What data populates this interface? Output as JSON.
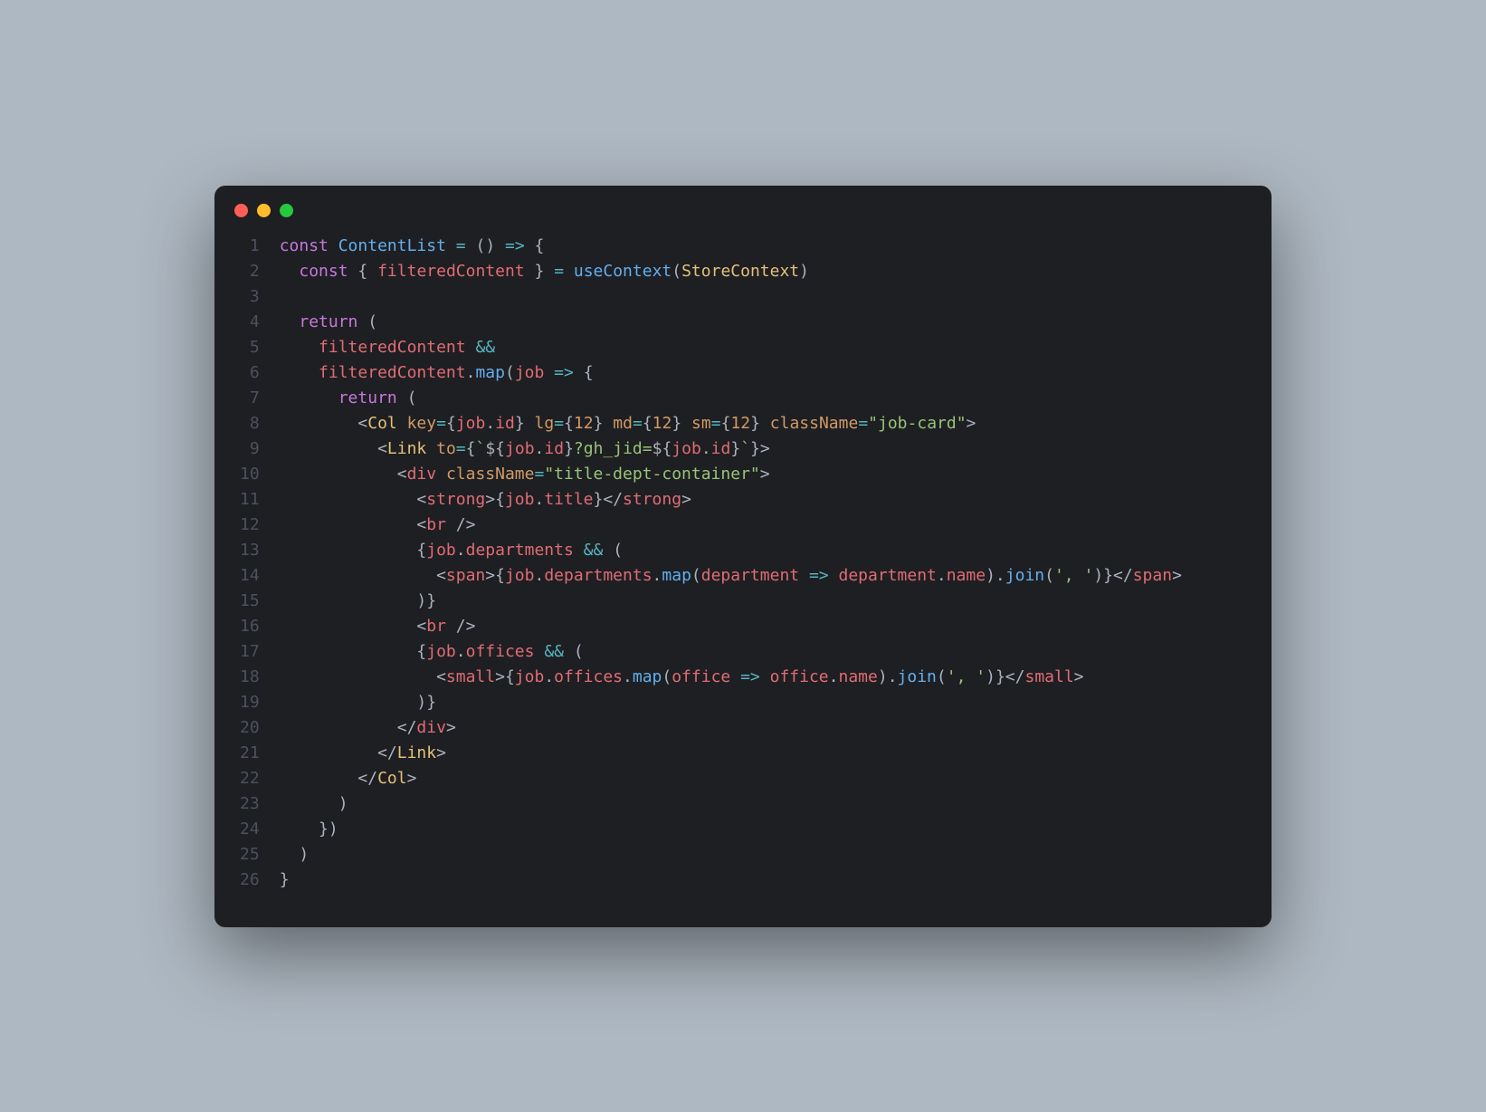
{
  "window": {
    "traffic_lights": {
      "red": "#ff5f56",
      "yellow": "#ffbd2e",
      "green": "#27c93f"
    }
  },
  "editor": {
    "line_count": 26,
    "lines": {
      "l1": "const ContentList = () => {",
      "l2": "  const { filteredContent } = useContext(StoreContext)",
      "l3": "",
      "l4": "  return (",
      "l5": "    filteredContent &&",
      "l6": "    filteredContent.map(job => {",
      "l7": "      return (",
      "l8": "        <Col key={job.id} lg={12} md={12} sm={12} className=\"job-card\">",
      "l9": "          <Link to={`${job.id}?gh_jid=${job.id}`}>",
      "l10": "            <div className=\"title-dept-container\">",
      "l11": "              <strong>{job.title}</strong>",
      "l12": "              <br />",
      "l13": "              {job.departments && (",
      "l14": "                <span>{job.departments.map(department => department.name).join(', ')}</span>",
      "l15": "              )}",
      "l16": "              <br />",
      "l17": "              {job.offices && (",
      "l18": "                <small>{job.offices.map(office => office.name).join(', ')}</small>",
      "l19": "              )}",
      "l20": "            </div>",
      "l21": "          </Link>",
      "l22": "        </Col>",
      "l23": "      )",
      "l24": "    })",
      "l25": "  )",
      "l26": "}"
    }
  },
  "tokens": {
    "const": "const",
    "ContentList": "ContentList",
    "eq": "=",
    "lpar": "(",
    "rpar": ")",
    "arrow": "=>",
    "lcb": "{",
    "rcb": "}",
    "filteredContent": "filteredContent",
    "useContext": "useContext",
    "StoreContext": "StoreContext",
    "return": "return",
    "ampamp": "&&",
    "dot": ".",
    "map": "map",
    "job": "job",
    "lt": "<",
    "gt": ">",
    "slash": "/",
    "Col": "Col",
    "key": "key",
    "id": "id",
    "lg": "lg",
    "md": "md",
    "sm": "sm",
    "n12": "12",
    "className": "className",
    "jobcard": "\"job-card\"",
    "Link": "Link",
    "to": "to",
    "bt": "`",
    "dollar": "$",
    "ghjid": "?gh_jid=",
    "div": "div",
    "titledept": "\"title-dept-container\"",
    "strong": "strong",
    "title": "title",
    "br": "br",
    "sp": " ",
    "departments": "departments",
    "span": "span",
    "department": "department",
    "name": "name",
    "join": "join",
    "commastr": "', '",
    "offices": "offices",
    "small": "small",
    "office": "office"
  }
}
